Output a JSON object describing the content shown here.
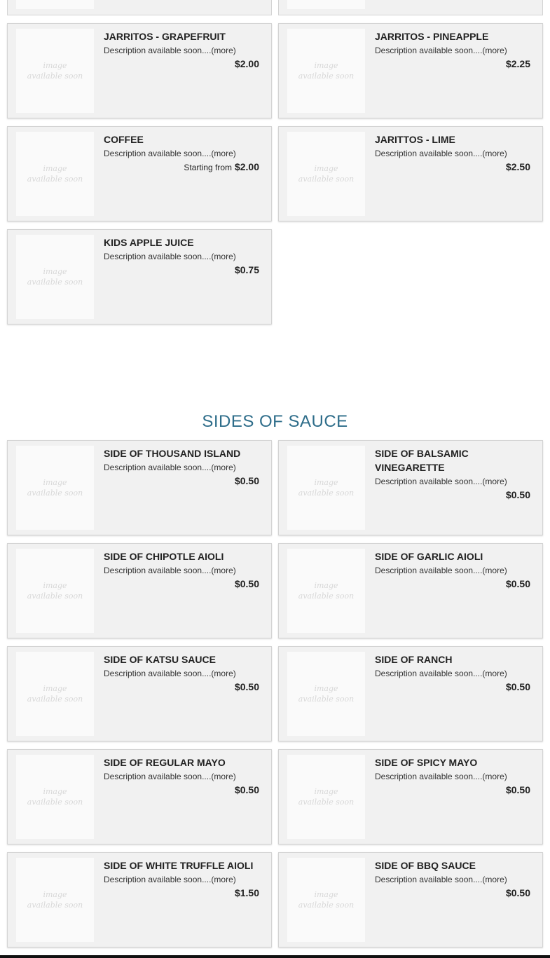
{
  "placeholder_image_text": [
    "image",
    "available soon"
  ],
  "drinks": [
    {
      "name": "JARRITOS - GRAPEFRUIT",
      "desc": "Description available soon....",
      "more": "(more)",
      "from": "",
      "price": "$2.00"
    },
    {
      "name": "JARRITOS - PINEAPPLE",
      "desc": "Description available soon....",
      "more": "(more)",
      "from": "",
      "price": "$2.25"
    },
    {
      "name": "COFFEE",
      "desc": "Description available soon....",
      "more": "(more)",
      "from": "Starting from",
      "price": "$2.00"
    },
    {
      "name": "JARITTOS - LIME",
      "desc": "Description available soon....",
      "more": "(more)",
      "from": "",
      "price": "$2.50"
    },
    {
      "name": "KIDS APPLE JUICE",
      "desc": "Description available soon....",
      "more": "(more)",
      "from": "",
      "price": "$0.75"
    }
  ],
  "sauces_section": {
    "title": "SIDES OF SAUCE",
    "items": [
      {
        "name": "SIDE OF THOUSAND ISLAND",
        "desc": "Description available soon....",
        "more": "(more)",
        "price": "$0.50"
      },
      {
        "name": "SIDE OF BALSAMIC VINEGARETTE",
        "desc": "Description available soon....",
        "more": "(more)",
        "price": "$0.50"
      },
      {
        "name": "SIDE OF CHIPOTLE AIOLI",
        "desc": "Description available soon....",
        "more": "(more)",
        "price": "$0.50"
      },
      {
        "name": "SIDE OF GARLIC AIOLI",
        "desc": "Description available soon....",
        "more": "(more)",
        "price": "$0.50"
      },
      {
        "name": "SIDE OF KATSU SAUCE",
        "desc": "Description available soon....",
        "more": "(more)",
        "price": "$0.50"
      },
      {
        "name": "SIDE OF RANCH",
        "desc": "Description available soon....",
        "more": "(more)",
        "price": "$0.50"
      },
      {
        "name": "SIDE OF REGULAR MAYO",
        "desc": "Description available soon....",
        "more": "(more)",
        "price": "$0.50"
      },
      {
        "name": "SIDE OF SPICY MAYO",
        "desc": "Description available soon....",
        "more": "(more)",
        "price": "$0.50"
      },
      {
        "name": "SIDE OF WHITE TRUFFLE AIOLI",
        "desc": "Description available soon....",
        "more": "(more)",
        "price": "$1.50"
      },
      {
        "name": "SIDE OF BBQ SAUCE",
        "desc": "Description available soon....",
        "more": "(more)",
        "price": "$0.50"
      }
    ]
  },
  "colors": {
    "section_title": "#2e6d8a",
    "card_bg": "#f1f1f1"
  }
}
